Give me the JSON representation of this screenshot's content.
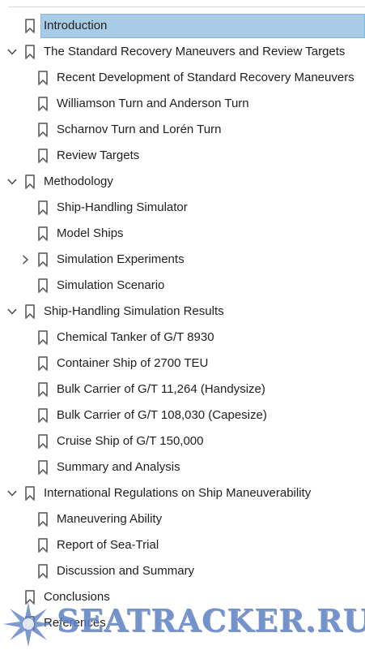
{
  "bookmarks": [
    {
      "label": "Introduction",
      "level": 0,
      "expander": "none",
      "selected": true
    },
    {
      "label": "The Standard Recovery Maneuvers and Review Targets",
      "level": 0,
      "expander": "expanded"
    },
    {
      "label": "Recent Development of Standard Recovery Maneuvers",
      "level": 1,
      "expander": "none"
    },
    {
      "label": "Williamson Turn and Anderson Turn",
      "level": 1,
      "expander": "none"
    },
    {
      "label": "Scharnov Turn and Lorén Turn",
      "level": 1,
      "expander": "none"
    },
    {
      "label": "Review Targets",
      "level": 1,
      "expander": "none"
    },
    {
      "label": "Methodology",
      "level": 0,
      "expander": "expanded"
    },
    {
      "label": "Ship-Handling Simulator",
      "level": 1,
      "expander": "none"
    },
    {
      "label": "Model Ships",
      "level": 1,
      "expander": "none"
    },
    {
      "label": "Simulation Experiments",
      "level": 1,
      "expander": "collapsed"
    },
    {
      "label": "Simulation Scenario",
      "level": 1,
      "expander": "none"
    },
    {
      "label": "Ship-Handling Simulation Results",
      "level": 0,
      "expander": "expanded"
    },
    {
      "label": "Chemical Tanker of G/T 8930",
      "level": 1,
      "expander": "none"
    },
    {
      "label": "Container Ship of 2700 TEU",
      "level": 1,
      "expander": "none"
    },
    {
      "label": "Bulk Carrier of G/T 11,264 (Handysize)",
      "level": 1,
      "expander": "none"
    },
    {
      "label": "Bulk Carrier of G/T 108,030 (Capesize)",
      "level": 1,
      "expander": "none"
    },
    {
      "label": "Cruise Ship of G/T 150,000",
      "level": 1,
      "expander": "none"
    },
    {
      "label": "Summary and Analysis",
      "level": 1,
      "expander": "none"
    },
    {
      "label": "International Regulations on Ship Maneuverability",
      "level": 0,
      "expander": "expanded"
    },
    {
      "label": "Maneuvering Ability",
      "level": 1,
      "expander": "none"
    },
    {
      "label": "Report of Sea-Trial",
      "level": 1,
      "expander": "none"
    },
    {
      "label": "Discussion and Summary",
      "level": 1,
      "expander": "none"
    },
    {
      "label": "Conclusions",
      "level": 0,
      "expander": "none"
    },
    {
      "label": "References",
      "level": 0,
      "expander": "none"
    }
  ],
  "watermark": {
    "text": "SEATRACKER.RU"
  },
  "icons": {
    "bookmark": "bookmark-icon",
    "expanded": "chevron-down-icon",
    "collapsed": "chevron-right-icon"
  },
  "colors": {
    "selection": "#a9cce6",
    "selection_border": "#87b6da",
    "icon": "#6b6b6b",
    "watermark": "#5c7fc4"
  }
}
